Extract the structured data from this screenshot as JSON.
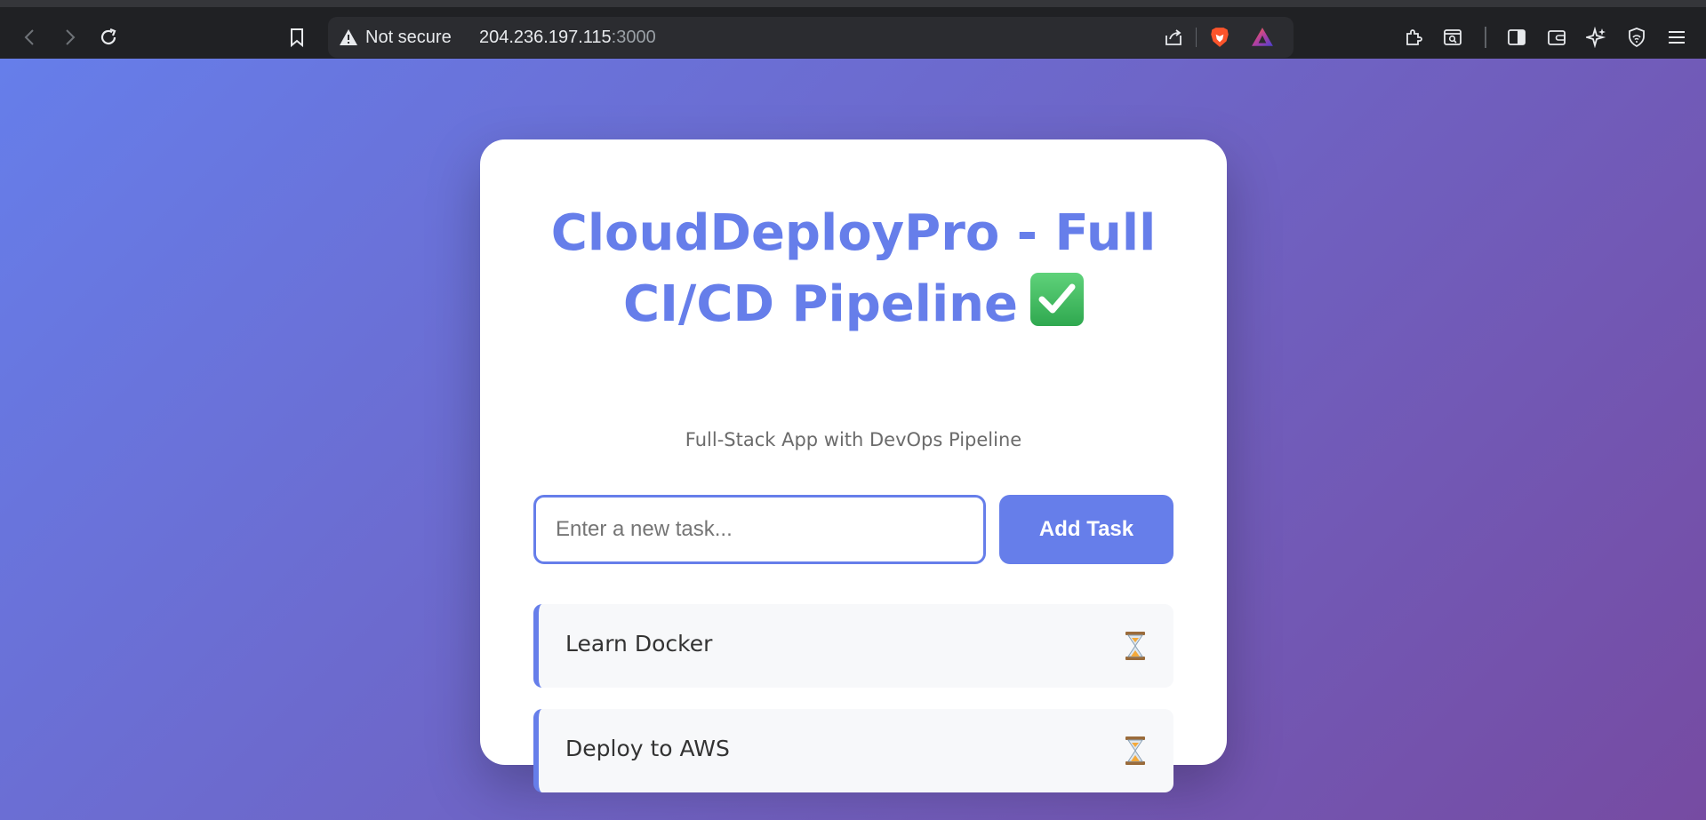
{
  "browser": {
    "security_label": "Not secure",
    "url_host": "204.236.197.115",
    "url_port": ":3000",
    "icons": {
      "back": "back-arrow-icon",
      "forward": "forward-arrow-icon",
      "reload": "reload-icon",
      "bookmark": "bookmark-icon",
      "warning": "warning-triangle-icon",
      "share": "share-icon",
      "brave_shields": "brave-lion-icon",
      "brave_rewards": "brave-rewards-triangle-icon",
      "extensions": "puzzle-icon",
      "sidebar": "sidebar-icon",
      "wallet": "wallet-icon",
      "leo": "sparkle-icon",
      "vpn": "shield-icon",
      "menu": "hamburger-menu-icon"
    }
  },
  "app": {
    "title": "CloudDeployPro - Full CI/CD Pipeline",
    "subtitle": "Full-Stack App with DevOps Pipeline",
    "input_placeholder": "Enter a new task...",
    "input_value": "",
    "add_button_label": "Add Task",
    "tasks": [
      {
        "text": "Learn Docker",
        "status_icon": "hourglass-icon"
      },
      {
        "text": "Deploy to AWS",
        "status_icon": "hourglass-icon"
      }
    ],
    "colors": {
      "accent": "#667eea",
      "gradient_start": "#667eea",
      "gradient_end": "#764ba2"
    }
  }
}
